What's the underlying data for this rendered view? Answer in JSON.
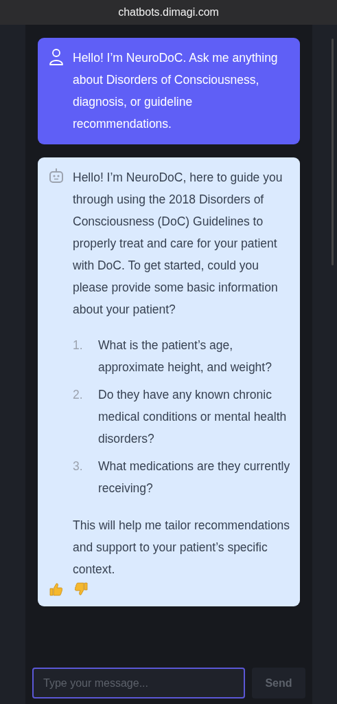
{
  "browser": {
    "address": "chatbots.dimagi.com"
  },
  "messages": [
    {
      "kind": "user",
      "text": "Hello! I’m NeuroDoC. Ask me anything about Disorders of Consciousness, diagnosis, or guideline recommendations."
    },
    {
      "kind": "bot",
      "intro": "Hello! I’m NeuroDoC, here to guide you through using the 2018 Disorders of Consciousness (DoC) Guidelines to properly treat and care for your patient with DoC. To get started, could you please provide some basic information about your patient?",
      "items": [
        {
          "number": "1.",
          "text": "What is the patient’s age, approximate height, and weight?"
        },
        {
          "number": "2.",
          "text": "Do they have any known chronic medical conditions or mental health disorders?"
        },
        {
          "number": "3.",
          "text": "What medications are they currently receiving?"
        }
      ],
      "closing": "This will help me tailor recommendations and support to your patient’s specific context."
    }
  ],
  "composer": {
    "placeholder": "Type your message...",
    "send_label": "Send",
    "send_disabled": true
  }
}
